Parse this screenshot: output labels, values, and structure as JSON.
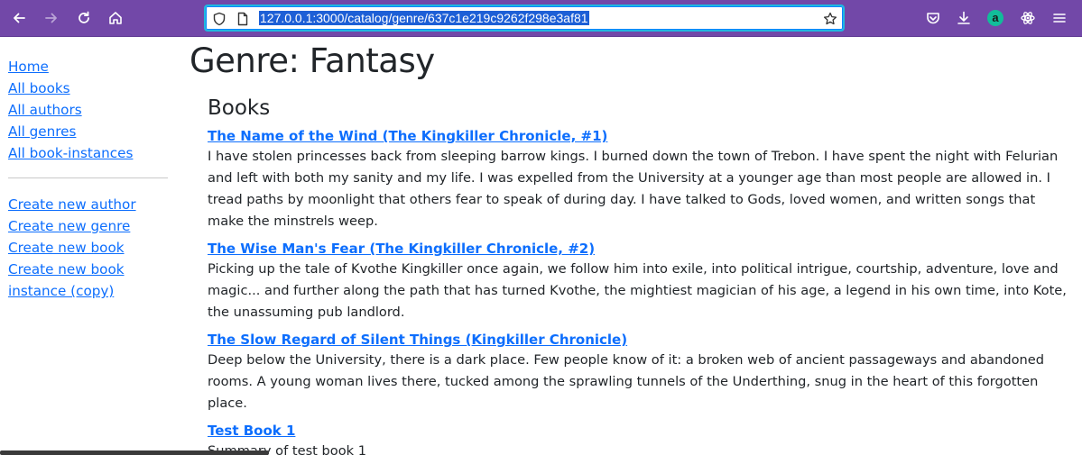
{
  "browser": {
    "url": "127.0.0.1:3000/catalog/genre/637c1e219c9262f298e3af81",
    "icons": [
      "back-icon",
      "forward-icon",
      "reload-icon",
      "home-icon",
      "shield-icon",
      "page-icon",
      "star-icon",
      "pocket-icon",
      "download-icon",
      "account-icon",
      "extension-icon",
      "menu-icon"
    ],
    "account_letter": "a"
  },
  "sidebar": {
    "nav": [
      {
        "label": "Home"
      },
      {
        "label": "All books"
      },
      {
        "label": "All authors"
      },
      {
        "label": "All genres"
      },
      {
        "label": "All book-instances"
      }
    ],
    "create": [
      {
        "label": "Create new author"
      },
      {
        "label": "Create new genre"
      },
      {
        "label": "Create new book"
      },
      {
        "label": "Create new book"
      },
      {
        "label": "instance (copy)"
      }
    ]
  },
  "main": {
    "title": "Genre: Fantasy",
    "section_title": "Books",
    "books": [
      {
        "title": "The Name of the Wind (The Kingkiller Chronicle, #1)",
        "summary": "I have stolen princesses back from sleeping barrow kings. I burned down the town of Trebon. I have spent the night with Felurian and left with both my sanity and my life. I was expelled from the University at a younger age than most people are allowed in. I tread paths by moonlight that others fear to speak of during day. I have talked to Gods, loved women, and written songs that make the minstrels weep."
      },
      {
        "title": "The Wise Man's Fear (The Kingkiller Chronicle, #2)",
        "summary": "Picking up the tale of Kvothe Kingkiller once again, we follow him into exile, into political intrigue, courtship, adventure, love and magic... and further along the path that has turned Kvothe, the mightiest magician of his age, a legend in his own time, into Kote, the unassuming pub landlord."
      },
      {
        "title": "The Slow Regard of Silent Things (Kingkiller Chronicle)",
        "summary": "Deep below the University, there is a dark place. Few people know of it: a broken web of ancient passageways and abandoned rooms. A young woman lives there, tucked among the sprawling tunnels of the Underthing, snug in the heart of this forgotten place."
      },
      {
        "title": "Test Book 1",
        "summary": "Summary of test book 1"
      }
    ]
  },
  "colors": {
    "toolbar": "#7248a8",
    "link": "#0d6efd",
    "url_focus": "#1fb8e0",
    "url_selection": "#1d5fd6",
    "text": "#212529"
  }
}
